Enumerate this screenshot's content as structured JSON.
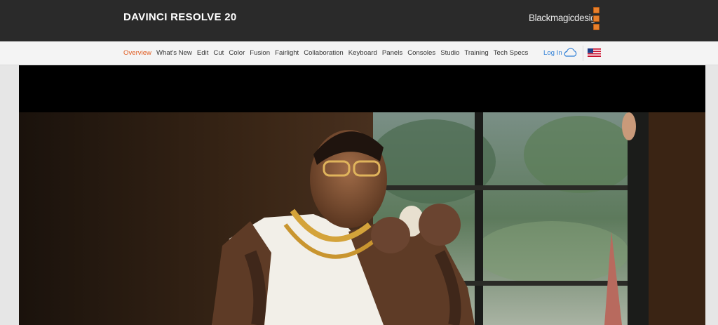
{
  "header": {
    "product_title": "DAVINCI RESOLVE 20",
    "brand_name": "Blackmagicdesign",
    "logo_icon": "blackmagic-logo-icon",
    "accent_color": "#e8802c"
  },
  "nav": {
    "items": [
      {
        "label": "Overview",
        "active": true
      },
      {
        "label": "What's New"
      },
      {
        "label": "Edit"
      },
      {
        "label": "Cut"
      },
      {
        "label": "Color"
      },
      {
        "label": "Fusion"
      },
      {
        "label": "Fairlight"
      },
      {
        "label": "Collaboration"
      },
      {
        "label": "Keyboard"
      },
      {
        "label": "Panels"
      },
      {
        "label": "Consoles"
      },
      {
        "label": "Studio"
      },
      {
        "label": "Training"
      },
      {
        "label": "Tech Specs"
      }
    ],
    "login_label": "Log In",
    "login_icon": "cloud-icon",
    "region_icon": "us-flag-icon",
    "active_color": "#e05a1e",
    "link_color": "#2f7fd6"
  },
  "hero": {
    "media": "video-frame",
    "description_icon": "hero-video"
  }
}
